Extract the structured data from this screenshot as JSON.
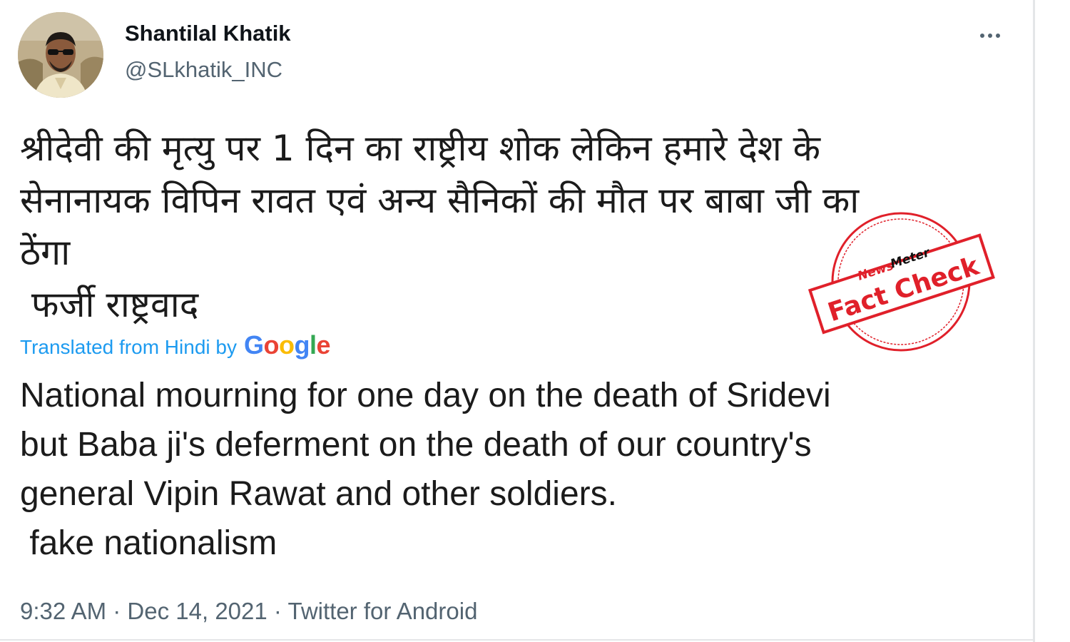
{
  "tweet": {
    "author_name": "Shantilal Khatik",
    "author_handle": "@SLkhatik_INC",
    "hindi_lines": [
      "श्रीदेवी की मृत्यु पर 1 दिन का राष्ट्रीय शोक लेकिन हमारे देश के",
      "सेनानायक विपिन रावत एवं अन्य सैनिकों की मौत पर बाबा जी का",
      "ठेंगा",
      " फर्जी राष्ट्रवाद"
    ],
    "translated_label": "Translated from Hindi by",
    "translation_provider": [
      "G",
      "o",
      "o",
      "g",
      "l",
      "e"
    ],
    "english_lines": [
      "National mourning for one day on the death of Sridevi",
      "but Baba ji's deferment on the death of our country's",
      "general Vipin Rawat and other soldiers.",
      " fake nationalism"
    ],
    "time": "9:32 AM",
    "date": "Dec 14, 2021",
    "source": "Twitter for Android",
    "separator": "·"
  },
  "stamp": {
    "brand_news": "News",
    "brand_meter": "Meter",
    "label": "Fact Check",
    "color": "#e0202a"
  },
  "colors": {
    "link": "#1d9bf0",
    "secondary_text": "#536471",
    "google": [
      "#4285F4",
      "#EA4335",
      "#FBBC05",
      "#4285F4",
      "#34A853",
      "#EA4335"
    ]
  }
}
